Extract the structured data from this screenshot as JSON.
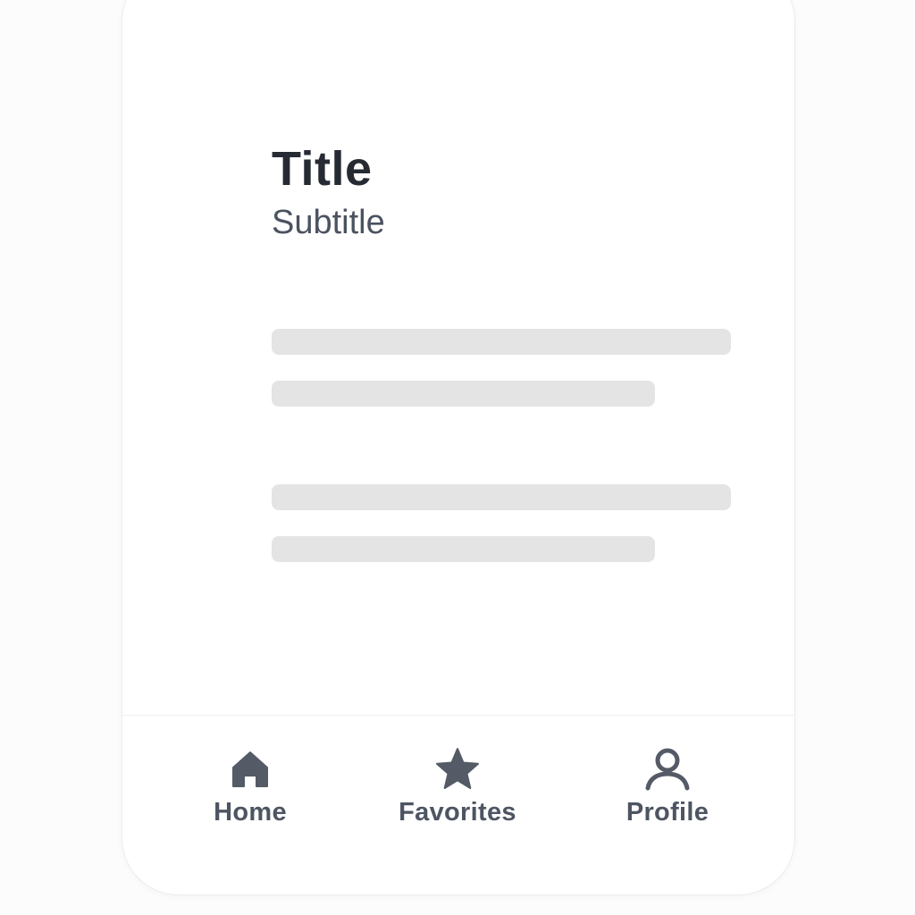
{
  "header": {
    "title": "Title",
    "subtitle": "Subtitle"
  },
  "body": {
    "placeholder_lines": 4
  },
  "bottom_nav": {
    "items": [
      {
        "label": "Home",
        "icon": "home-icon"
      },
      {
        "label": "Favorites",
        "icon": "star-icon"
      },
      {
        "label": "Profile",
        "icon": "user-icon"
      }
    ]
  },
  "colors": {
    "title": "#252a33",
    "subtitle": "#4b5260",
    "skeleton": "#e4e4e4",
    "nav_icon": "#545b66",
    "background": "#ffffff"
  }
}
